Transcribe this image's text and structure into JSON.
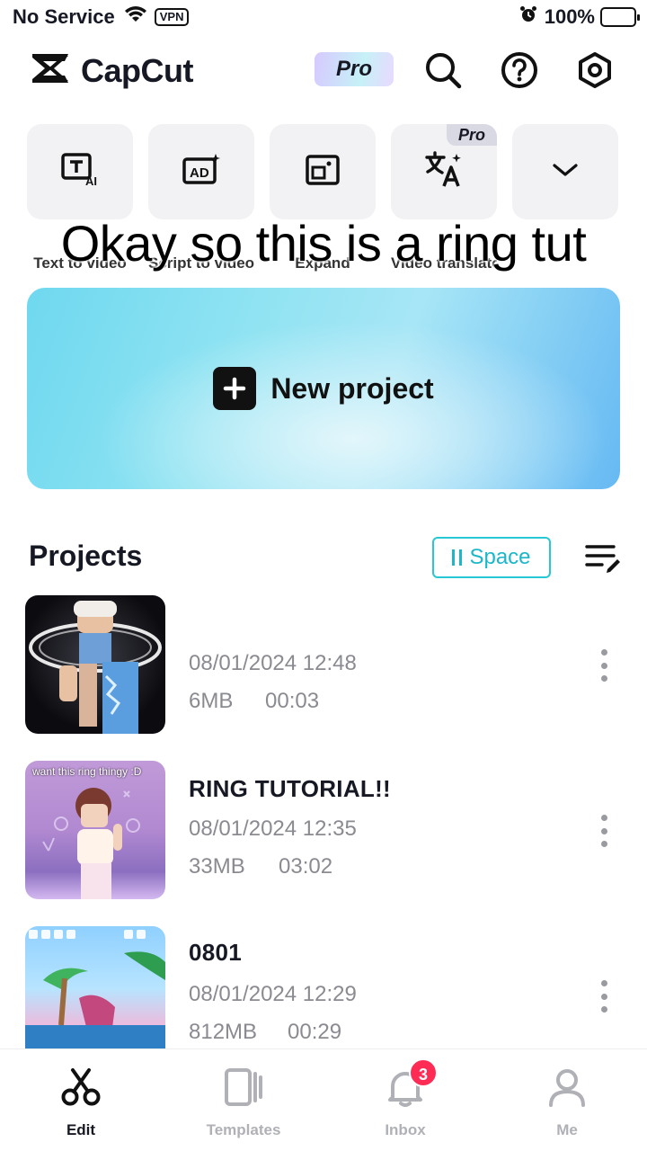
{
  "status_bar": {
    "carrier": "No Service",
    "vpn": "VPN",
    "battery": "100%",
    "icons": [
      "wifi-icon",
      "alarm-icon",
      "battery-charging-icon"
    ]
  },
  "header": {
    "app_name": "CapCut",
    "pro_label": "Pro",
    "icons": [
      "search-icon",
      "help-icon",
      "settings-icon"
    ]
  },
  "shortcuts": [
    {
      "label": "Text to video",
      "icon": "text-ai-icon"
    },
    {
      "label": "Script to video",
      "icon": "ad-sparkle-icon"
    },
    {
      "label": "Expand",
      "icon": "crop-icon"
    },
    {
      "label": "Video translator",
      "icon": "translate-icon",
      "pro": "Pro"
    },
    {
      "label": "",
      "icon": "chevron-down-icon"
    }
  ],
  "caption": "Okay so this is a ring tut",
  "new_project": {
    "label": "New project"
  },
  "projects": {
    "title": "Projects",
    "space_label": "Space",
    "items": [
      {
        "name": "",
        "date": "08/01/2024 12:48",
        "size": "6MB",
        "duration": "00:03"
      },
      {
        "name": "RING TUTORIAL!!",
        "date": "08/01/2024 12:35",
        "size": "33MB",
        "duration": "03:02",
        "thumb_caption": "want this ring thingy :D"
      },
      {
        "name": "0801",
        "date": "08/01/2024 12:29",
        "size": "812MB",
        "duration": "00:29"
      }
    ]
  },
  "nav": {
    "items": [
      {
        "label": "Edit",
        "icon": "scissors-icon",
        "active": true
      },
      {
        "label": "Templates",
        "icon": "templates-icon"
      },
      {
        "label": "Inbox",
        "icon": "bell-icon",
        "badge": "3"
      },
      {
        "label": "Me",
        "icon": "profile-icon"
      }
    ]
  },
  "colors": {
    "accent": "#1cb7c8",
    "badge": "#fe2c55",
    "text": "#161823",
    "muted": "#8a8b91"
  }
}
